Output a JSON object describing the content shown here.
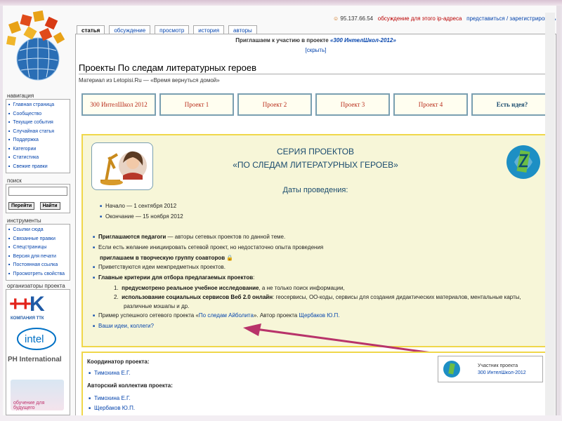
{
  "topbar": {
    "ip": "95.137.66.54",
    "talk_link": "обсуждение для этого ip-адреса",
    "login_link": "представиться / зарегистрироваться"
  },
  "tabs": [
    "статья",
    "обсуждение",
    "просмотр",
    "история",
    "авторы"
  ],
  "sitenotice": {
    "text": "Приглашаем к участию в проекте",
    "project": "«300 ИнтелШкол-2012»",
    "hide": "[скрыть]"
  },
  "page": {
    "title": "Проекты По следам литературных героев",
    "subtitle": "Материал из Letopisi.Ru — «Время вернуться домой»"
  },
  "project_nav": [
    {
      "label": "300 ИнтелШкол 2012"
    },
    {
      "label": "Проект 1"
    },
    {
      "label": "Проект 2"
    },
    {
      "label": "Проект 3"
    },
    {
      "label": "Проект 4"
    },
    {
      "label": "Есть идея?"
    }
  ],
  "main": {
    "series_title": "СЕРИЯ ПРОЕКТОВ",
    "series_name": "«ПО СЛЕДАМ ЛИТЕРАТУРНЫХ ГЕРОЕВ»",
    "dates_heading": "Даты проведения:",
    "dates": [
      "Начало — 1 сентября 2012",
      "Окончание — 15 ноября 2012"
    ],
    "invite_bold": "Приглашаются педагоги",
    "invite_rest": " — авторы сетевых проектов по данной теме.",
    "if_wish": "Если есть желание инициировать сетевой проект, но недостаточно опыта проведения",
    "coauthors_link": "приглашаем в творческую группу соавторов",
    "interdisciplinary": "Приветствуются идеи межпредметных проектов.",
    "criteria_bold": "Главные критерии для отбора предлагаемых проектов",
    "criteria_colon": ":",
    "crit1_bold": "предусмотрено реальное учебное исследование",
    "crit1_rest": ", а не только поиск информации,",
    "crit2_bold": "использование социальных сервисов Веб 2.0 онлайн",
    "crit2_rest": ": геосервисы, ОО-коды, сервисы для создания дидактических материалов, ментальные карты,",
    "crit2_cont": "различные мэшапы и др.",
    "example_prefix": "Пример успешного сетевого проекта «",
    "example_link": "По следам Айболита",
    "example_mid": "». Автор проекта ",
    "example_author": "Щербаков Ю.П.",
    "ideas_link": "Ваши идеи, коллеги?"
  },
  "bottom": {
    "coordinator_label": "Координатор проекта",
    "coordinator": "Тимохина Е.Г.",
    "team_label": "Авторский коллектив проекта",
    "team": [
      "Тимохина Е.Г.",
      "Щербаков Ю.П."
    ],
    "badge_line1": "Участник проекта",
    "badge_line2": "300 ИнтелШкол-2012"
  },
  "sidebar": {
    "nav_title": "навигация",
    "nav_items": [
      "Главная страница",
      "Сообщество",
      "Текущие события",
      "Случайная статья",
      "Поддержка",
      "Категории",
      "Статистика",
      "Свежие правки"
    ],
    "search_title": "поиск",
    "go_button": "Перейти",
    "find_button": "Найти",
    "tools_title": "инструменты",
    "tools_items": [
      "Ссылки сюда",
      "Связанные правки",
      "Спецстраницы",
      "Версия для печати",
      "Постоянная ссылка",
      "Просмотреть свойства"
    ],
    "org_title": "организаторы проекта",
    "sponsor_ttk_caption": "КОМПАНИЯ ТТК",
    "sponsor_ph_caption": "PH International",
    "sponsor_edu_caption": "обучение для будущего"
  },
  "colors": {
    "accent": "#1a4b6e",
    "link": "#0645ad",
    "project_red": "#b82b19",
    "box_border": "#f0d74a",
    "box_bg": "#f7f6d8",
    "arrow": "#b8336a"
  }
}
